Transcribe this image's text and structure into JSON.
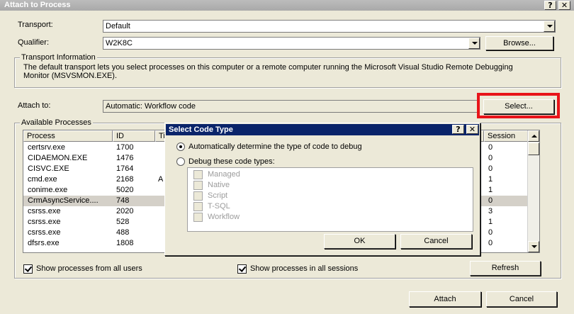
{
  "window": {
    "title": "Attach to Process",
    "help_glyph": "?",
    "close_glyph": "✕"
  },
  "transport": {
    "label": "Transport:",
    "value": "Default"
  },
  "qualifier": {
    "label": "Qualifier:",
    "value": "W2K8C",
    "browse_label": "Browse..."
  },
  "transport_info": {
    "title": "Transport Information",
    "text": "The default transport lets you select processes on this computer or a remote computer running the Microsoft Visual Studio Remote Debugging Monitor (MSVSMON.EXE)."
  },
  "attach_to": {
    "label": "Attach to:",
    "value": "Automatic: Workflow code",
    "select_label": "Select..."
  },
  "available_processes": {
    "title": "Available Processes",
    "columns": {
      "process": "Process",
      "id": "ID",
      "title": "Ti",
      "session": "Session"
    },
    "rows": [
      {
        "process": "certsrv.exe",
        "id": "1700",
        "title": "",
        "session": "0"
      },
      {
        "process": "CIDAEMON.EXE",
        "id": "1476",
        "title": "",
        "session": "0"
      },
      {
        "process": "CISVC.EXE",
        "id": "1764",
        "title": "",
        "session": "0"
      },
      {
        "process": "cmd.exe",
        "id": "2168",
        "title": "A",
        "session": "1"
      },
      {
        "process": "conime.exe",
        "id": "5020",
        "title": "",
        "session": "1"
      },
      {
        "process": "CrmAsyncService....",
        "id": "748",
        "title": "",
        "session": "0"
      },
      {
        "process": "csrss.exe",
        "id": "2020",
        "title": "",
        "session": "3"
      },
      {
        "process": "csrss.exe",
        "id": "528",
        "title": "",
        "session": "1"
      },
      {
        "process": "csrss.exe",
        "id": "488",
        "title": "",
        "session": "0"
      },
      {
        "process": "dfsrs.exe",
        "id": "1808",
        "title": "",
        "session": "0"
      }
    ]
  },
  "options": {
    "all_users": "Show processes from all users",
    "all_sessions": "Show processes in all sessions",
    "refresh_label": "Refresh"
  },
  "footer": {
    "attach_label": "Attach",
    "cancel_label": "Cancel"
  },
  "dialog": {
    "title": "Select Code Type",
    "help_glyph": "?",
    "close_glyph": "✕",
    "auto_label": "Automatically determine the type of code to debug",
    "debug_these_label": "Debug these code types:",
    "code_types": [
      "Managed",
      "Native",
      "Script",
      "T-SQL",
      "Workflow"
    ],
    "ok_label": "OK",
    "cancel_label": "Cancel"
  },
  "colors": {
    "highlight": "#e8141a",
    "dialog_title": "#0a246a",
    "face": "#ece9d8"
  }
}
